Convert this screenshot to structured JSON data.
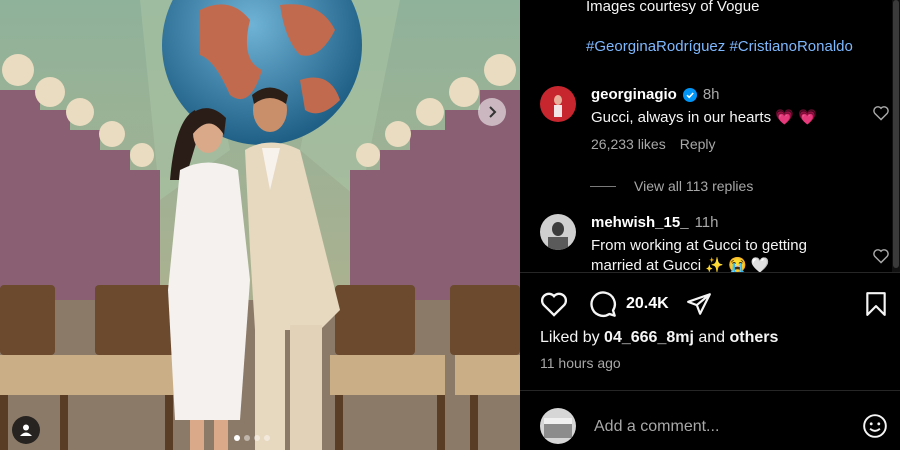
{
  "caption": {
    "credit": "Images courtesy of Vogue",
    "hashtags": [
      "#GeorginaRodríguez",
      "#CristianoRonaldo"
    ]
  },
  "comments": [
    {
      "username": "georginagio",
      "verified": true,
      "time": "8h",
      "text": "Gucci, always in our hearts 💗 💗",
      "likes": "26,233 likes",
      "reply_label": "Reply"
    },
    {
      "username": "mehwish_15_",
      "verified": false,
      "time": "11h",
      "text": "From working at Gucci to getting married at Gucci ✨ 😭 🤍"
    }
  ],
  "view_replies": "View all 113 replies",
  "actions": {
    "comment_count": "20.4K",
    "icons": [
      "heart-icon",
      "comment-icon",
      "share-icon",
      "bookmark-icon"
    ]
  },
  "liked_by": {
    "prefix": "Liked by",
    "user": "04_666_8mj",
    "conjunction": "and",
    "others": "others"
  },
  "post_time": "11 hours ago",
  "add_comment": {
    "placeholder": "Add a comment..."
  },
  "carousel": {
    "total_slides": 4,
    "active_index": 0
  },
  "colors": {
    "background": "#000000",
    "hashtag": "#7eb8ff",
    "verified": "#0095f6",
    "muted_text": "#a8a8a8"
  }
}
